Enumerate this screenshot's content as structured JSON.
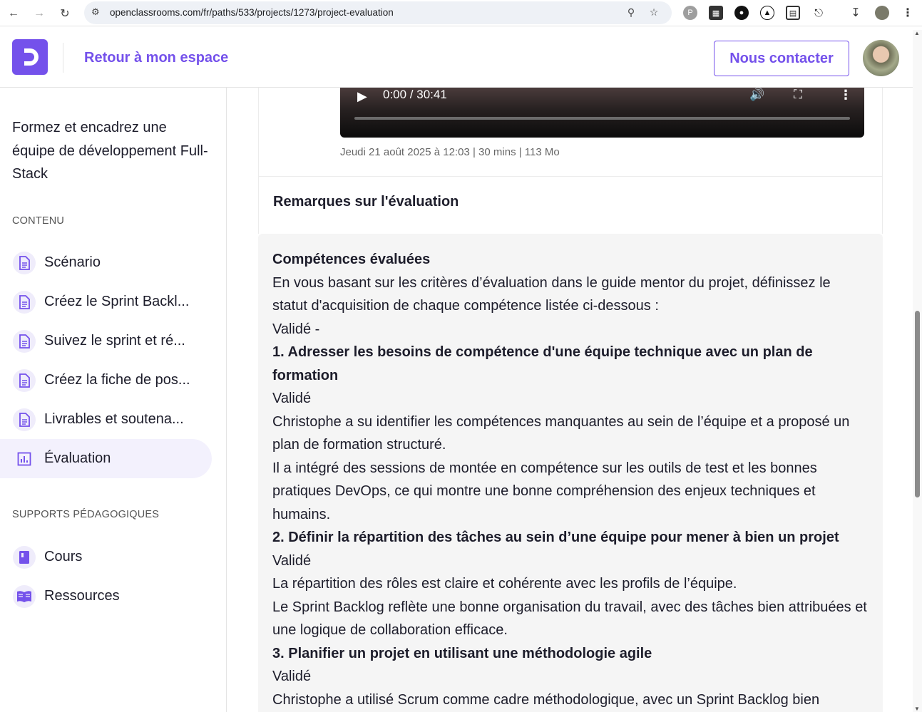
{
  "browser": {
    "url": "openclassrooms.com/fr/paths/533/projects/1273/project-evaluation"
  },
  "header": {
    "back_label": "Retour à mon espace",
    "contact_label": "Nous contacter"
  },
  "sidebar": {
    "course_title": "Formez et encadrez une équipe de développement Full-Stack",
    "content_label": "CONTENU",
    "items": [
      {
        "label": "Scénario",
        "icon": "document-icon"
      },
      {
        "label": "Créez le Sprint Backl...",
        "icon": "document-icon"
      },
      {
        "label": "Suivez le sprint et ré...",
        "icon": "document-icon"
      },
      {
        "label": "Créez la fiche de pos...",
        "icon": "document-icon"
      },
      {
        "label": "Livrables et soutena...",
        "icon": "document-icon"
      },
      {
        "label": "Évaluation",
        "icon": "chart-icon"
      }
    ],
    "supports_label": "SUPPORTS PÉDAGOGIQUES",
    "supports": [
      {
        "label": "Cours",
        "icon": "book-icon"
      },
      {
        "label": "Ressources",
        "icon": "open-book-icon"
      }
    ]
  },
  "video": {
    "time": "0:00 / 30:41",
    "meta": "Jeudi 21 août 2025 à 12:03 | 30 mins | 113 Mo",
    "progress": 0
  },
  "remarks": {
    "title": "Remarques sur l'évaluation"
  },
  "evaluation": {
    "heading": "Compétences évaluées",
    "intro": "En vous basant sur les critères d’évaluation dans le guide mentor du projet, définissez le statut d'acquisition de chaque compétence listée ci-dessous :",
    "validated_line": "Validé -",
    "skills": [
      {
        "title": "1. Adresser les besoins de compétence d'une équipe technique avec un plan de formation",
        "status": "Validé",
        "comments": [
          "Christophe a su identifier les compétences manquantes au sein de l’équipe et a proposé un plan de formation structuré.",
          "Il a intégré des sessions de montée en compétence sur les outils de test et les bonnes pratiques DevOps, ce qui montre une bonne compréhension des enjeux techniques et humains."
        ]
      },
      {
        "title": "2. Définir la répartition des tâches au sein d’une équipe pour mener à bien un projet",
        "status": "Validé",
        "comments": [
          "La répartition des rôles est claire et cohérente avec les profils de l’équipe.",
          "Le Sprint Backlog reflète une bonne organisation du travail, avec des tâches bien attribuées et une logique de collaboration efficace."
        ]
      },
      {
        "title": "3. Planifier un projet en utilisant une méthodologie agile",
        "status": "Validé",
        "comments": [
          "Christophe a utilisé Scrum comme cadre méthodologique, avec un Sprint Backlog bien"
        ]
      }
    ]
  },
  "colors": {
    "accent": "#7451eb",
    "text": "#1d1d2b",
    "panel": "#f5f5f5"
  }
}
